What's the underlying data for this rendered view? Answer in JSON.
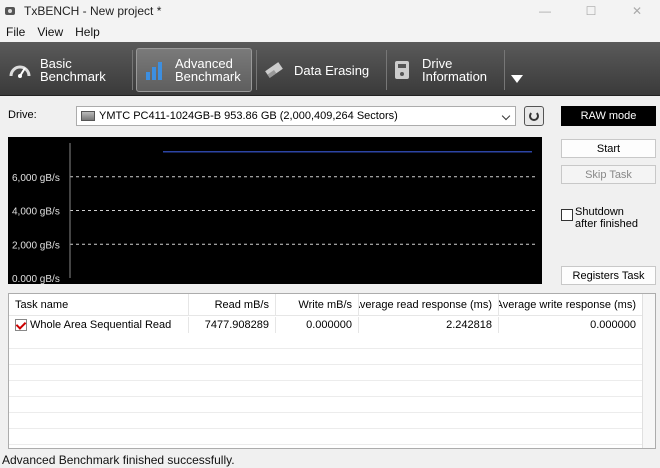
{
  "window": {
    "title": "TxBENCH - New project *",
    "controls": [
      "—",
      "☐",
      "✕"
    ]
  },
  "menu": [
    "File",
    "View",
    "Help"
  ],
  "toolbar": {
    "tabs": [
      {
        "line1": "Basic",
        "line2": "Benchmark"
      },
      {
        "line1": "Advanced",
        "line2": "Benchmark"
      },
      {
        "line1": "Data Erasing",
        "line2": ""
      },
      {
        "line1": "Drive",
        "line2": "Information"
      }
    ]
  },
  "drive": {
    "label": "Drive:",
    "selected": "YMTC PC411-1024GB-B  953.86 GB (2,000,409,264 Sectors)",
    "raw_mode_label": "RAW mode"
  },
  "chart_data": {
    "type": "line",
    "title": "",
    "xlabel": "",
    "ylabel": "",
    "y_ticks": [
      "6,000 gB/s",
      "4,000 gB/s",
      "2,000 gB/s",
      "0.000 gB/s"
    ],
    "ylim": [
      0,
      8000
    ],
    "grid": true,
    "series": [
      {
        "values": [
          7478,
          7478,
          7478,
          7478,
          7478
        ],
        "color": "#3b5bdb"
      }
    ]
  },
  "side": {
    "start_label": "Start",
    "skip_label": "Skip Task",
    "shutdown_line1": "Shutdown",
    "shutdown_line2": "after finished",
    "registers_label": "Registers Task"
  },
  "table": {
    "columns": [
      "Task name",
      "Read mB/s",
      "Write mB/s",
      "Average read response (ms)",
      "Average write response (ms)"
    ],
    "rows": [
      {
        "task": "Whole Area Sequential Read",
        "read": "7477.908289",
        "write": "0.000000",
        "avg_read": "2.242818",
        "avg_write": "0.000000"
      }
    ]
  },
  "status": {
    "text": "Advanced Benchmark finished successfully."
  }
}
